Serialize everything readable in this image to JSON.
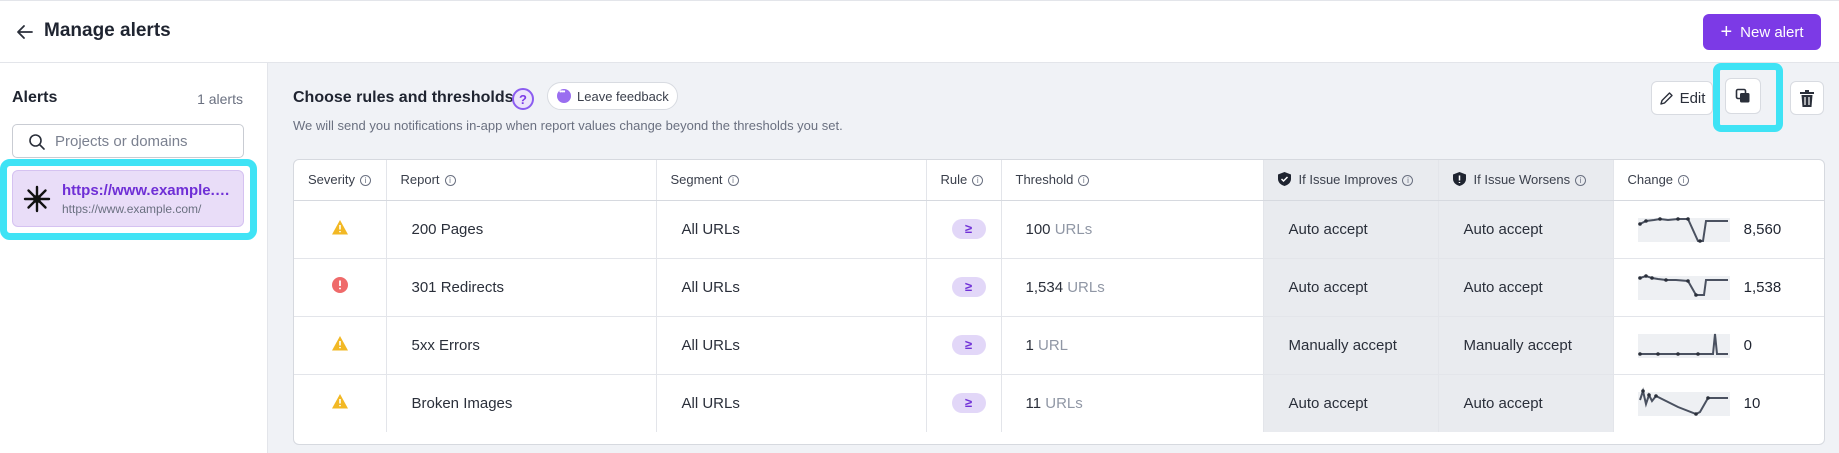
{
  "header": {
    "title": "Manage alerts",
    "new_alert_label": "New alert"
  },
  "sidebar": {
    "title": "Alerts",
    "count": "1 alerts",
    "search_placeholder": "Projects or domains",
    "projects": [
      {
        "url": "https://www.example.com/",
        "sub": "https://www.example.com/"
      }
    ]
  },
  "main": {
    "title": "Choose rules and thresholds",
    "help_label": "?",
    "feedback_label": "Leave feedback",
    "description": "We will send you notifications in-app when report values change beyond the thresholds you set.",
    "edit_label": "Edit"
  },
  "table": {
    "headers": {
      "severity": "Severity",
      "report": "Report",
      "segment": "Segment",
      "rule": "Rule",
      "threshold": "Threshold",
      "improves": "If Issue Improves",
      "worsens": "If Issue Worsens",
      "change": "Change"
    },
    "rows": [
      {
        "severity": "warning",
        "report": "200 Pages",
        "segment": "All URLs",
        "rule": "≥",
        "threshold_value": "100",
        "threshold_unit": "URLs",
        "improves": "Auto accept",
        "worsens": "Auto accept",
        "change": "8,560"
      },
      {
        "severity": "error",
        "report": "301 Redirects",
        "segment": "All URLs",
        "rule": "≥",
        "threshold_value": "1,534",
        "threshold_unit": "URLs",
        "improves": "Auto accept",
        "worsens": "Auto accept",
        "change": "1,538"
      },
      {
        "severity": "warning",
        "report": "5xx Errors",
        "segment": "All URLs",
        "rule": "≥",
        "threshold_value": "1",
        "threshold_unit": "URL",
        "improves": "Manually accept",
        "worsens": "Manually accept",
        "change": "0"
      },
      {
        "severity": "warning",
        "report": "Broken Images",
        "segment": "All URLs",
        "rule": "≥",
        "threshold_value": "11",
        "threshold_unit": "URLs",
        "improves": "Auto accept",
        "worsens": "Auto accept",
        "change": "10"
      }
    ]
  },
  "colors": {
    "accent": "#7c3ae6",
    "highlight": "#3fe3f5",
    "warning": "#f2b824",
    "error": "#ef6a6a"
  }
}
